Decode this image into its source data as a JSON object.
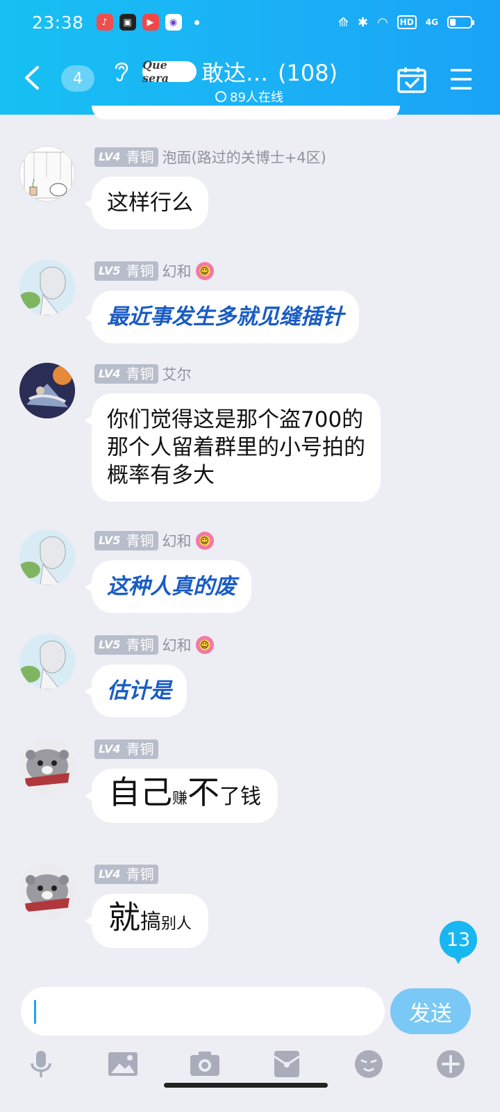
{
  "status_bar": {
    "time": "23:38",
    "net": "4G",
    "hd": "HD",
    "battery_level": 0.3
  },
  "header": {
    "back_icon": "chevron-left-icon",
    "unread_badge": "4",
    "logo_text": "Que sera",
    "title": "敢达…",
    "member_count": "(108)",
    "online": "89人在线",
    "calendar_icon": "calendar-check-icon",
    "menu_icon": "hamburger-icon"
  },
  "messages": [
    {
      "level": "LV4",
      "rank": "青铜",
      "nick": "泡面(路过的关博士+4区)",
      "lines": [
        "这样行么"
      ],
      "style": "normal"
    },
    {
      "level": "LV5",
      "rank": "青铜",
      "nick": "幻和",
      "lines": [
        "最近事发生多就见缝插针"
      ],
      "style": "blue"
    },
    {
      "level": "LV4",
      "rank": "青铜",
      "nick": "艾尔",
      "lines": [
        "你们觉得这是那个盗700的",
        "那个人留着群里的小号拍的",
        "概率有多大"
      ],
      "style": "normal"
    },
    {
      "level": "LV5",
      "rank": "青铜",
      "nick": "幻和",
      "lines": [
        "这种人真的废"
      ],
      "style": "blue"
    },
    {
      "level": "LV5",
      "rank": "青铜",
      "nick": "幻和",
      "lines": [
        "估计是"
      ],
      "style": "blue"
    },
    {
      "level": "LV4",
      "rank": "青铜",
      "nick": "",
      "parts": [
        "自己",
        "赚",
        "不",
        "了钱"
      ],
      "style": "mixed"
    },
    {
      "level": "LV4",
      "rank": "青铜",
      "nick": "",
      "parts": [
        "就",
        "搞",
        "别人"
      ],
      "style": "mixed"
    }
  ],
  "new_messages_count": "13",
  "composer": {
    "value": "",
    "send_label": "发送"
  },
  "toolbar_icons": [
    "microphone-icon",
    "image-icon",
    "camera-icon",
    "red-packet-icon",
    "emoji-icon",
    "plus-icon"
  ]
}
